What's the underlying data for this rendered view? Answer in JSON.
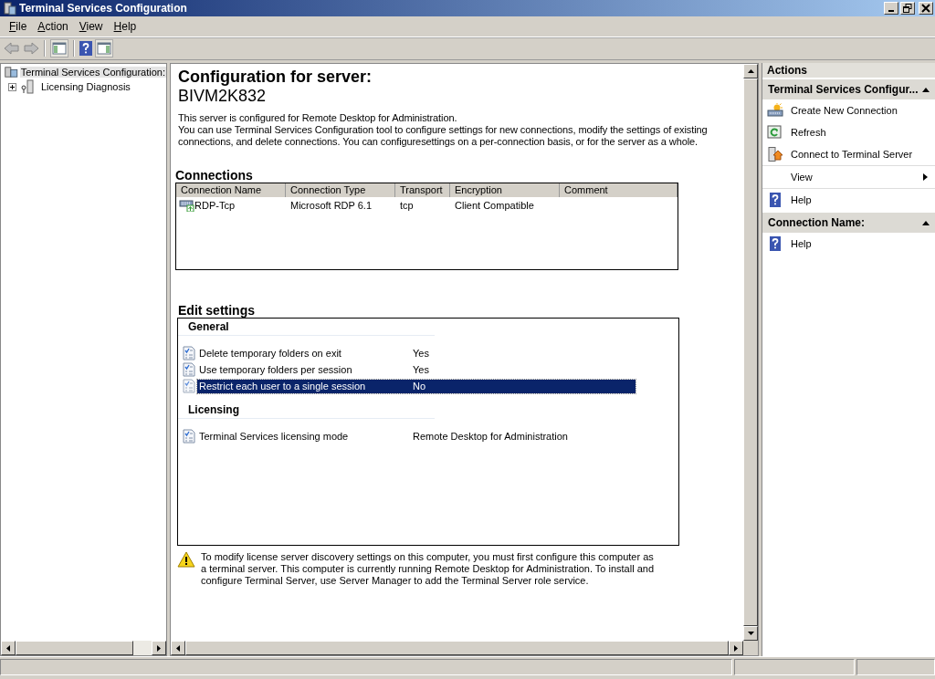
{
  "window": {
    "title": "Terminal Services Configuration"
  },
  "menu": [
    "File",
    "Action",
    "View",
    "Help"
  ],
  "tree": [
    {
      "label": "Terminal Services Configuration:",
      "selected": true,
      "children": [
        {
          "label": "Licensing Diagnosis",
          "selected": false,
          "expanded": false
        }
      ]
    }
  ],
  "content": {
    "title": "Configuration for server:",
    "server": "BIVM2K832",
    "description": [
      "This server is configured for Remote Desktop for Administration.",
      "You can use Terminal Services Configuration tool to configure settings for new connections, modify the settings of existing connections, and delete connections. You can configuresettings on a per-connection basis, or for the server as a whole."
    ],
    "connections": {
      "heading": "Connections",
      "columns": [
        "Connection Name",
        "Connection Type",
        "Transport",
        "Encryption",
        "Comment"
      ],
      "rows": [
        {
          "cells": [
            "RDP-Tcp",
            "Microsoft RDP 6.1",
            "tcp",
            "Client Compatible",
            null
          ],
          "selected": false
        }
      ]
    },
    "edit_settings": {
      "heading": "Edit settings",
      "groups": [
        {
          "name": "General",
          "items": [
            {
              "label": "Delete temporary folders on exit",
              "value": "Yes",
              "selected": false
            },
            {
              "label": "Use temporary folders per session",
              "value": "Yes",
              "selected": false
            },
            {
              "label": "Restrict each user to a single session",
              "value": "No",
              "selected": true
            }
          ]
        },
        {
          "name": "Licensing",
          "items": [
            {
              "label": "Terminal Services licensing mode",
              "value": "Remote Desktop for Administration",
              "selected": false
            }
          ]
        }
      ]
    },
    "warning": "To modify license server discovery settings on this computer, you must first configure this computer as a terminal server. This computer is currently running Remote Desktop for Administration. To install and configure Terminal Server, use Server Manager to add the Terminal Server role service."
  },
  "actions": {
    "title": "Actions",
    "sections": [
      {
        "title": "Terminal Services Configur...",
        "expanded": true,
        "items": [
          {
            "label": "Create New Connection",
            "kind": "new"
          },
          {
            "label": "Refresh",
            "kind": "refresh"
          },
          {
            "label": "Connect to Terminal Server",
            "kind": "connect"
          },
          {
            "label": "View",
            "kind": "submenu"
          },
          {
            "label": "Help",
            "kind": "help"
          }
        ]
      },
      {
        "title": "Connection Name:",
        "expanded": true,
        "items": [
          {
            "label": "Help",
            "kind": "help"
          }
        ]
      }
    ]
  }
}
